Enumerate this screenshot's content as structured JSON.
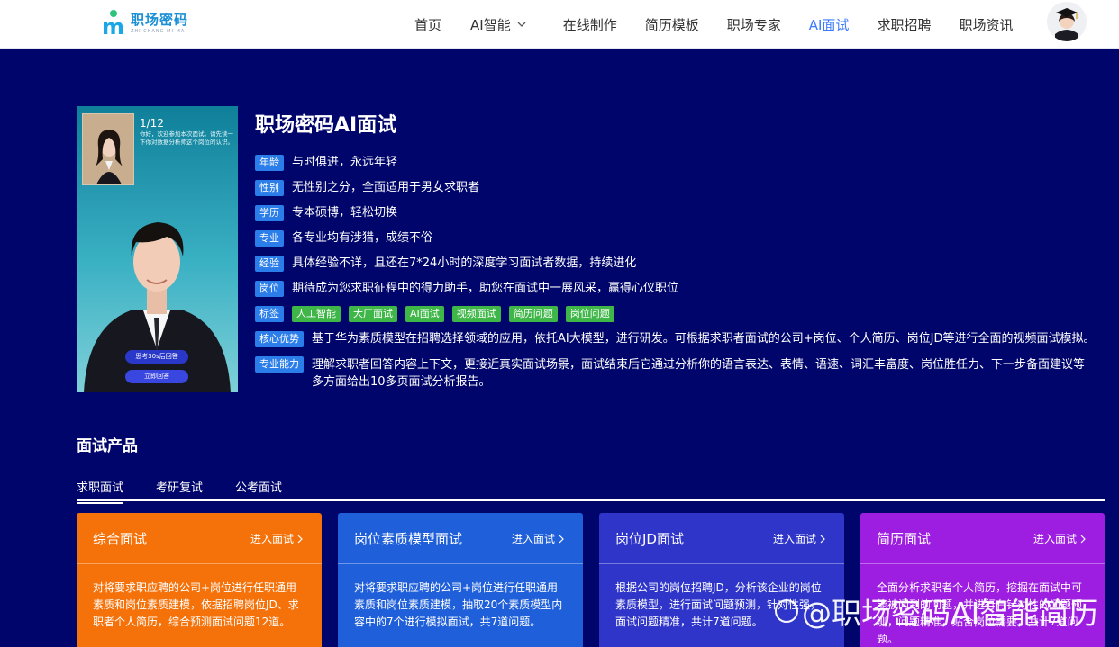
{
  "header": {
    "logo_text": "职场密码",
    "logo_sub": "ZHI CHANG MI MA",
    "nav": [
      {
        "label": "首页"
      },
      {
        "label": "AI智能"
      },
      {
        "label": "在线制作"
      },
      {
        "label": "简历模板"
      },
      {
        "label": "职场专家"
      },
      {
        "label": "AI面试"
      },
      {
        "label": "求职招聘"
      },
      {
        "label": "职场资讯"
      }
    ],
    "active_nav": "AI面试"
  },
  "hero": {
    "counter": "1/12",
    "question": "你好，欢迎参加本次面试。请先读一下你对数据分析师这个岗位的认识。",
    "think_button": "思考30s后回答",
    "answer_button": "立即回答",
    "title": "职场密码AI面试",
    "attributes": [
      {
        "tag": "年龄",
        "text": "与时俱进，永远年轻"
      },
      {
        "tag": "性别",
        "text": "无性别之分，全面适用于男女求职者"
      },
      {
        "tag": "学历",
        "text": "专本硕博，轻松切换"
      },
      {
        "tag": "专业",
        "text": "各专业均有涉猎，成绩不俗"
      },
      {
        "tag": "经验",
        "text": "具体经验不详，且还在7*24小时的深度学习面试者数据，持续进化"
      },
      {
        "tag": "岗位",
        "text": "期待成为您求职征程中的得力助手，助您在面试中一展风采，赢得心仪职位"
      }
    ],
    "labels_tag": "标签",
    "labels": [
      "人工智能",
      "大厂面试",
      "AI面试",
      "视频面试",
      "简历问题",
      "岗位问题"
    ],
    "core_tag": "核心优势",
    "core_text": "基于华为素质模型在招聘选择领域的应用，依托AI大模型，进行研发。可根据求职者面试的公司+岗位、个人简历、岗位JD等进行全面的视频面试模拟。",
    "ability_tag": "专业能力",
    "ability_text": "理解求职者回答内容上下文，更接近真实面试场景，面试结束后它通过分析你的语言表达、表情、语速、词汇丰富度、岗位胜任力、下一步备面建议等多方面给出10多页面试分析报告。"
  },
  "products": {
    "title": "面试产品",
    "tabs": [
      "求职面试",
      "考研复试",
      "公考面试"
    ],
    "enter_label": "进入面试",
    "cards": [
      {
        "name": "综合面试",
        "color": "#f5720a",
        "desc": "对将要求职应聘的公司+岗位进行任职通用素质和岗位素质建模，依据招聘岗位JD、求职者个人简历，综合预测面试问题12道。"
      },
      {
        "name": "岗位素质模型面试",
        "color": "#1f5fd9",
        "desc": "对将要求职应聘的公司+岗位进行任职通用素质和岗位素质建模，抽取20个素质模型内容中的7个进行模拟面试，共7道问题。"
      },
      {
        "name": "岗位JD面试",
        "color": "#2f35c9",
        "desc": "根据公司的岗位招聘JD，分析该企业的岗位素质模型，进行面试问题预测，针对性强，面试问题精准，共计7道问题。"
      },
      {
        "name": "简历面试",
        "color": "#9d1de0",
        "desc": "全面分析求职者个人简历，挖掘在面试中可能被问到的问题，并进行有针对性的问题预测，问题精准，贴合岗位需要，共计7道问题。"
      }
    ]
  },
  "watermark": "@职场密码AI智能简历"
}
